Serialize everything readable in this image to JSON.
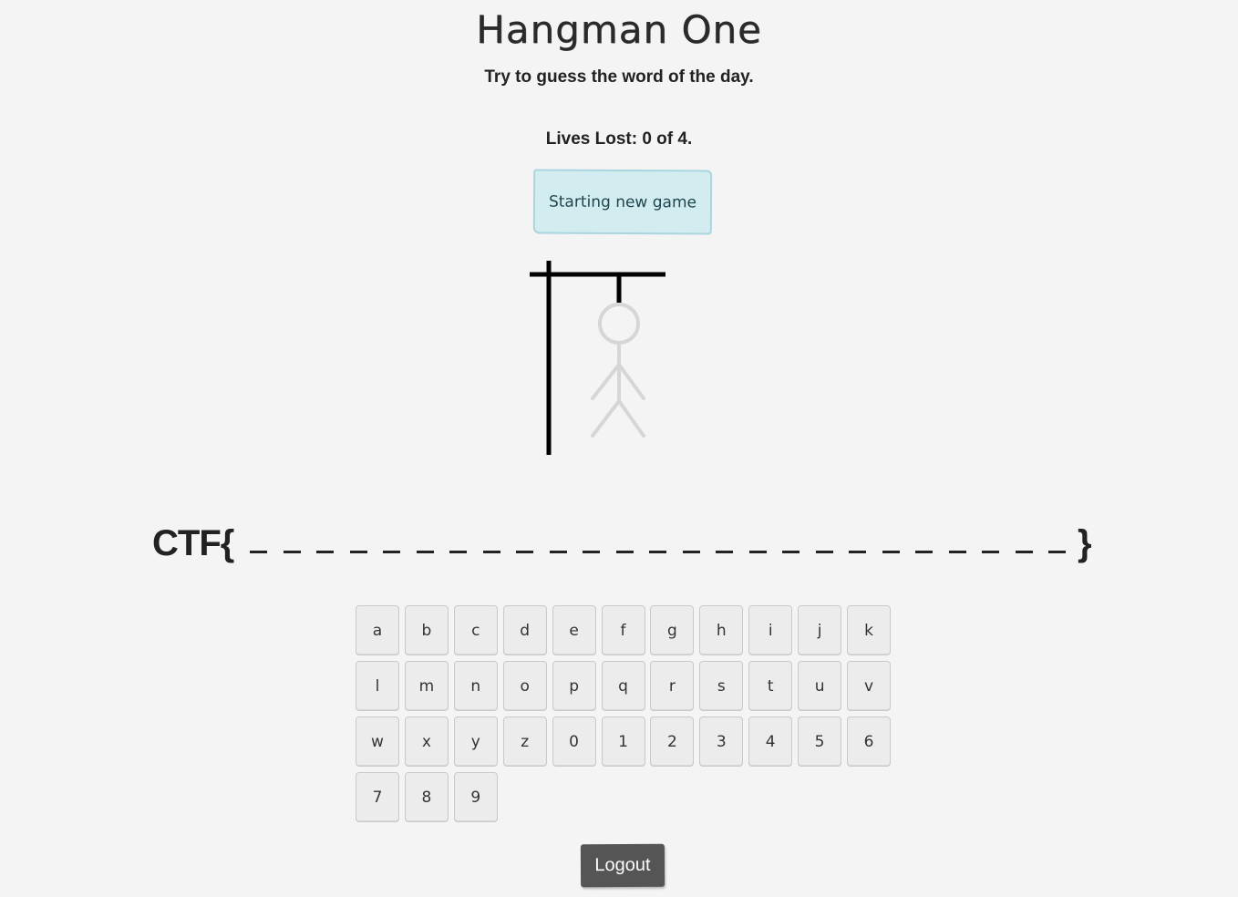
{
  "header": {
    "title": "Hangman One",
    "subtitle": "Try to guess the word of the day."
  },
  "game": {
    "lives_text": "Lives Lost: 0 of 4.",
    "lives_lost": 0,
    "lives_total": 4,
    "status_message": "Starting new game",
    "status_color": "#d3ecf0"
  },
  "word": {
    "prefix": "CTF{",
    "suffix": "}",
    "slot_count": 25
  },
  "keyboard": {
    "keys": [
      "a",
      "b",
      "c",
      "d",
      "e",
      "f",
      "g",
      "h",
      "i",
      "j",
      "k",
      "l",
      "m",
      "n",
      "o",
      "p",
      "q",
      "r",
      "s",
      "t",
      "u",
      "v",
      "w",
      "x",
      "y",
      "z",
      "0",
      "1",
      "2",
      "3",
      "4",
      "5",
      "6",
      "7",
      "8",
      "9"
    ]
  },
  "footer": {
    "logout_label": "Logout"
  }
}
